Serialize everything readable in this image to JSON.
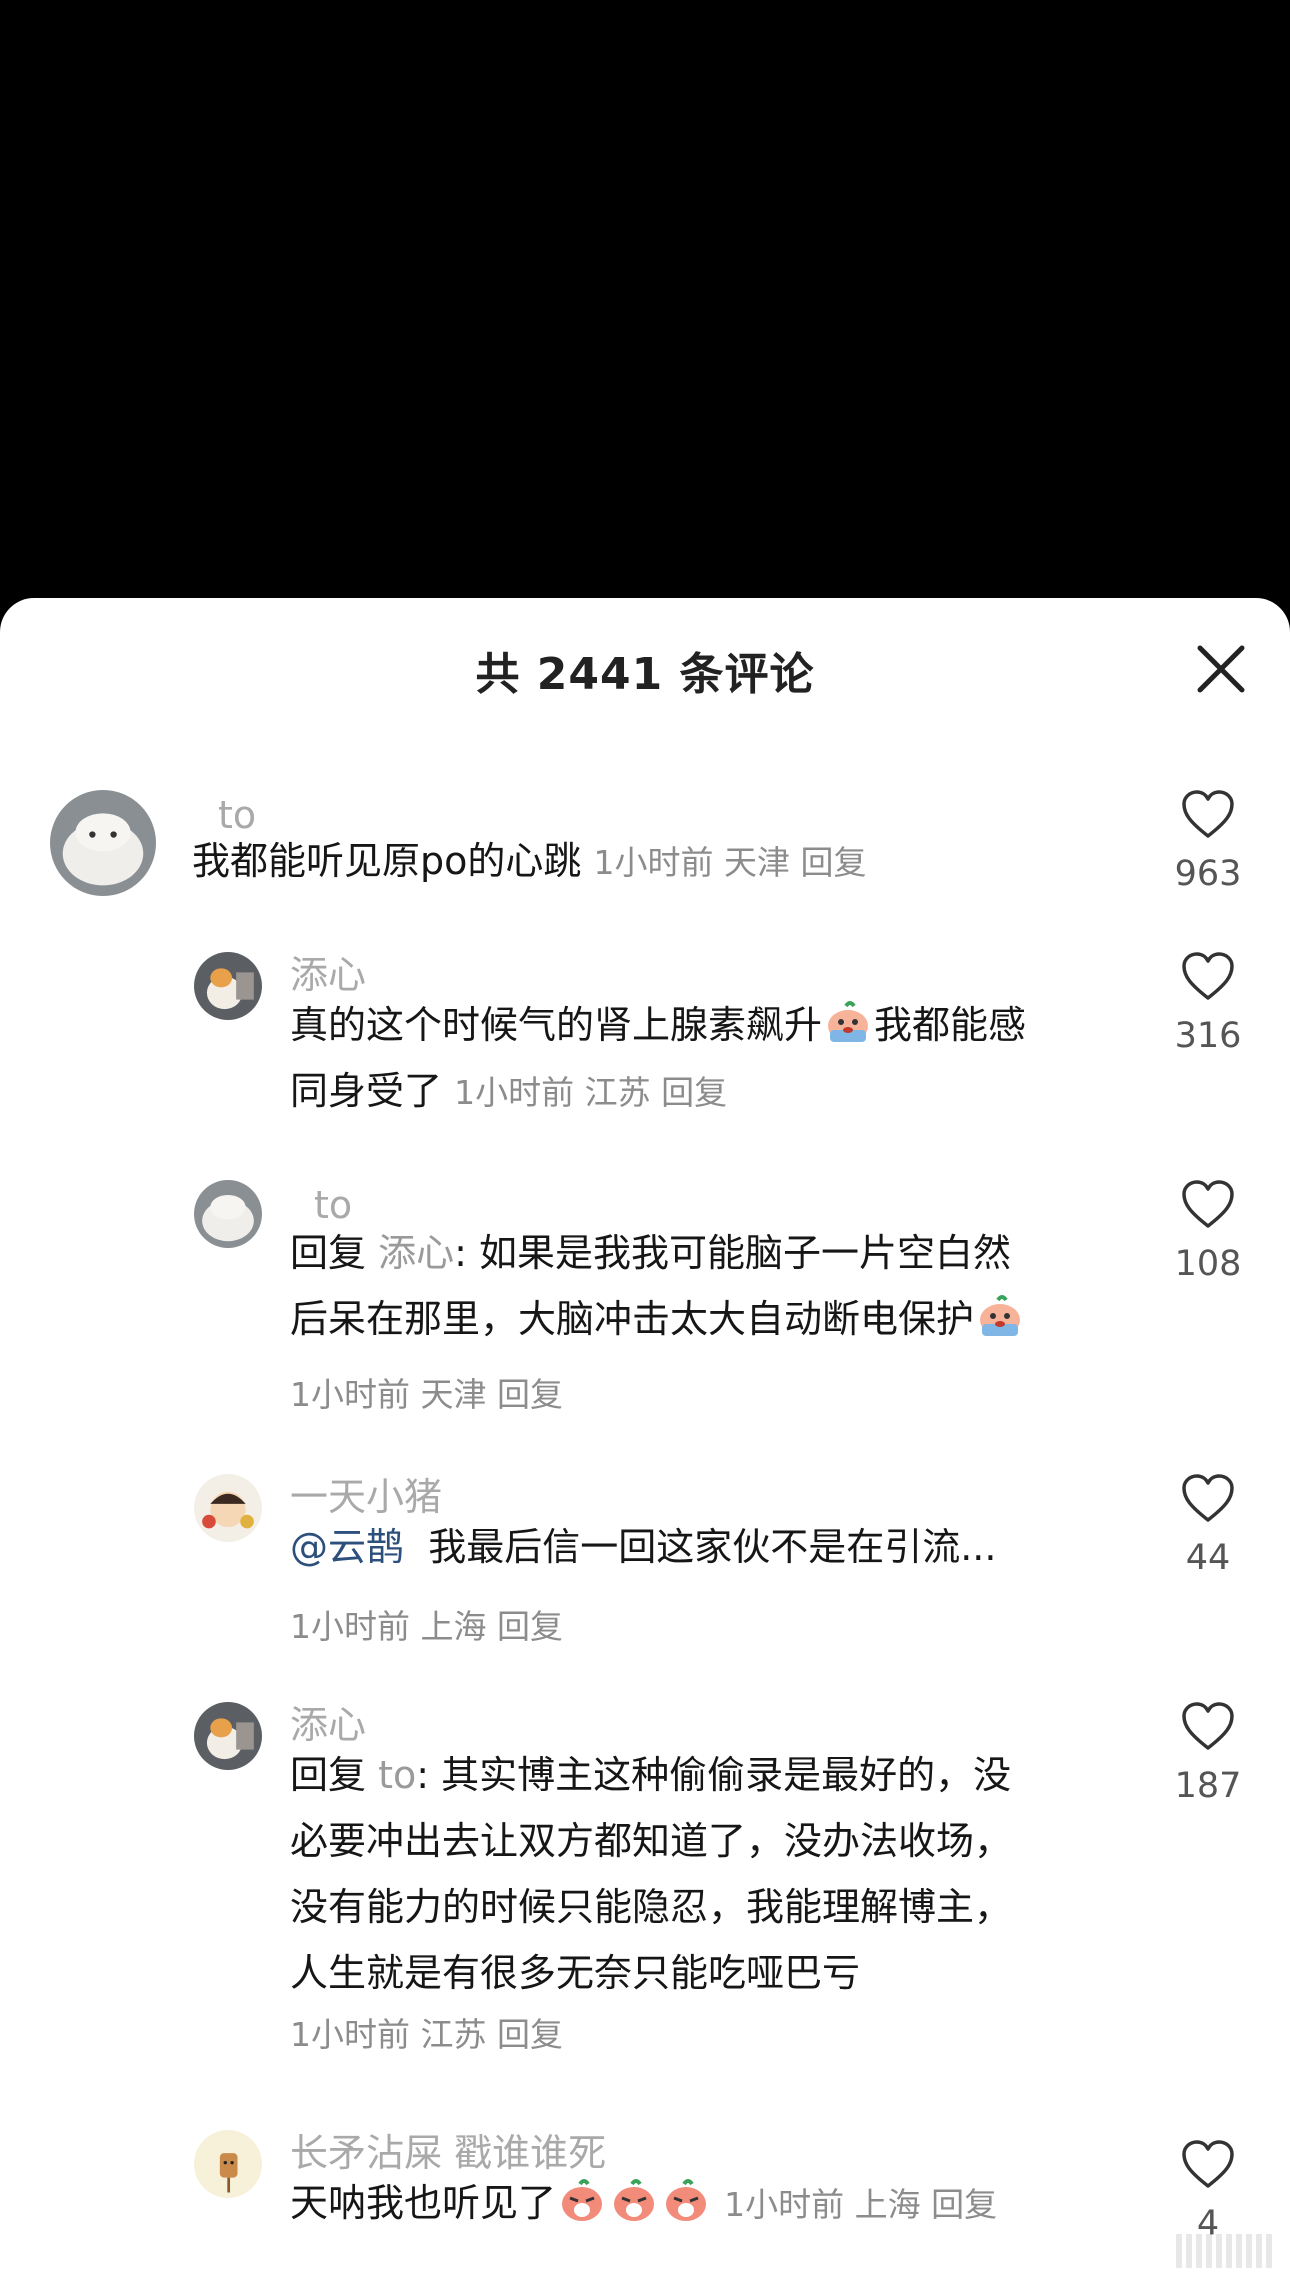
{
  "header": {
    "title": "共 2441 条评论",
    "close_icon": "close-icon"
  },
  "comments": [
    {
      "username": "to",
      "text": "我都能听见原po的心跳",
      "time": "1小时前",
      "location": "天津",
      "reply_label": "回复",
      "likes": "963"
    },
    {
      "username": "添心",
      "text_part1": "真的这个时候气的肾上腺素飙升",
      "text_part2": "我都能感",
      "text_part3": "同身受了",
      "emoji": "crying-face-emoji",
      "time": "1小时前",
      "location": "江苏",
      "reply_label": "回复",
      "likes": "316"
    },
    {
      "username": "to",
      "reply_prefix": "回复",
      "reply_to": "添心",
      "text_part1": ": 如果是我我可能脑子一片空白然",
      "text_part2": "后呆在那里，大脑冲击太大自动断电保护",
      "emoji": "crying-face-emoji",
      "time": "1小时前",
      "location": "天津",
      "reply_label": "回复",
      "likes": "108"
    },
    {
      "username": "一天小猪",
      "mention": "@云鹊",
      "text": "我最后信一回这家伙不是在引流...",
      "time": "1小时前",
      "location": "上海",
      "reply_label": "回复",
      "likes": "44"
    },
    {
      "username": "添心",
      "reply_prefix": "回复",
      "reply_to": "to",
      "line1": ": 其实博主这种偷偷录是最好的，没",
      "line2": "必要冲出去让双方都知道了，没办法收场，",
      "line3": "没有能力的时候只能隐忍，我能理解博主，",
      "line4": "人生就是有很多无奈只能吃哑巴亏",
      "time": "1小时前",
      "location": "江苏",
      "reply_label": "回复",
      "likes": "187"
    },
    {
      "username": "长矛沾屎 戳谁谁死",
      "text": "天呐我也听见了",
      "emoji": "screaming-face-emoji",
      "time": "1小时前",
      "location": "上海",
      "reply_label": "回复",
      "likes": "4"
    }
  ],
  "colors": {
    "background_top": "#000000",
    "sheet": "#ffffff",
    "username": "#a9a9a9",
    "meta": "#8c8c8c",
    "mention": "#2d4f7c"
  }
}
